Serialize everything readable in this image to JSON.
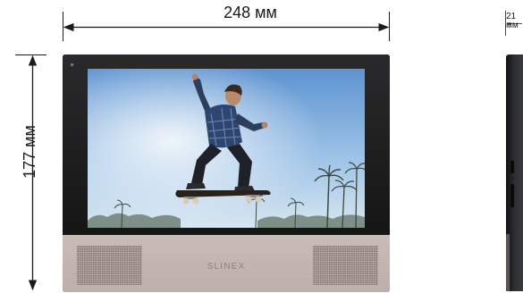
{
  "dimensions": {
    "width_label": "248 мм",
    "height_label": "177 мм",
    "depth_value": "21",
    "depth_unit": "мм"
  },
  "monitor": {
    "brand": "SLINEX"
  },
  "colors": {
    "line": "#1a1a1a",
    "bezel": "#1c1c1e",
    "lower_panel": "#c3b6b0",
    "speaker_grille": "#b3a49f",
    "brand_text": "#8f807b",
    "sky_top": "#5d93d1",
    "sky_bottom": "#d7e6f1"
  }
}
